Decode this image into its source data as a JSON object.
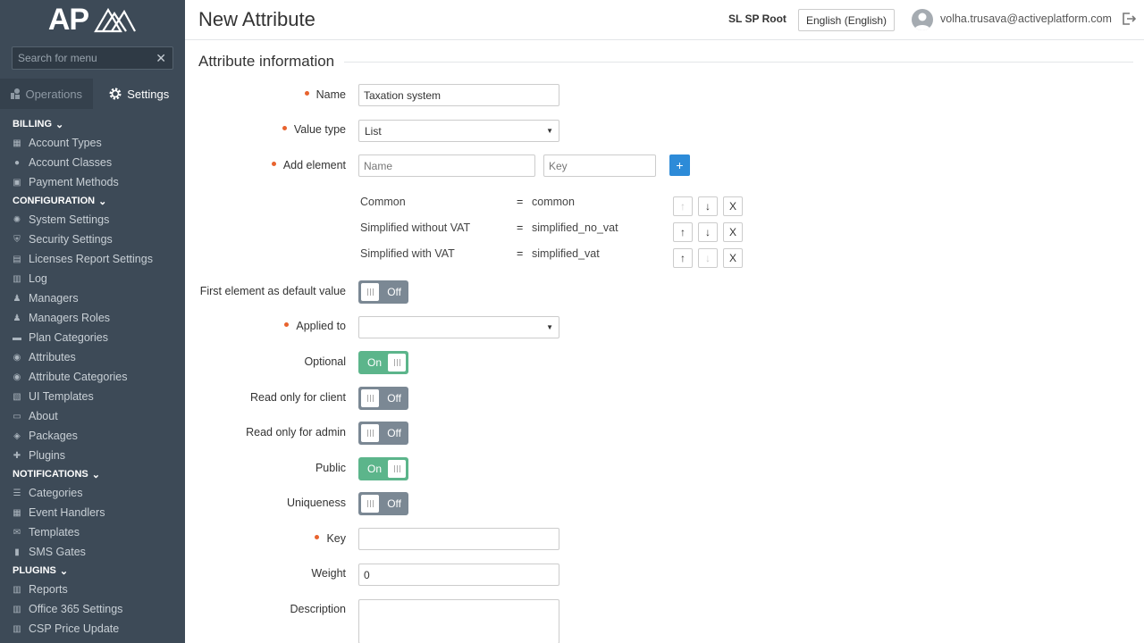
{
  "colors": {
    "sidebar_bg": "#3d4a57",
    "accent_blue": "#2d8bd8",
    "toggle_on": "#5cb58b",
    "toggle_off": "#7b8894",
    "required_dot": "#e8632e"
  },
  "sidebar": {
    "logo_text": "AP",
    "search_placeholder": "Search for menu",
    "tabs": [
      {
        "label": "Operations",
        "icon": "operations-icon"
      },
      {
        "label": "Settings",
        "icon": "gear-icon"
      }
    ],
    "sections": [
      {
        "title": "BILLING",
        "items": [
          {
            "label": "Account Types",
            "icon": "grid-icon"
          },
          {
            "label": "Account Classes",
            "icon": "user-icon"
          },
          {
            "label": "Payment Methods",
            "icon": "payment-icon"
          }
        ]
      },
      {
        "title": "CONFIGURATION",
        "items": [
          {
            "label": "System Settings",
            "icon": "gear-icon"
          },
          {
            "label": "Security Settings",
            "icon": "shield-icon"
          },
          {
            "label": "Licenses Report Settings",
            "icon": "document-icon"
          },
          {
            "label": "Log",
            "icon": "log-icon"
          },
          {
            "label": "Managers",
            "icon": "users-icon"
          },
          {
            "label": "Managers Roles",
            "icon": "users-icon"
          },
          {
            "label": "Plan Categories",
            "icon": "folder-icon"
          },
          {
            "label": "Attributes",
            "icon": "circle-icon"
          },
          {
            "label": "Attribute Categories",
            "icon": "circle-icon"
          },
          {
            "label": "UI Templates",
            "icon": "template-icon"
          },
          {
            "label": "About",
            "icon": "monitor-icon"
          },
          {
            "label": "Packages",
            "icon": "package-icon"
          },
          {
            "label": "Plugins",
            "icon": "plugin-icon"
          }
        ]
      },
      {
        "title": "NOTIFICATIONS",
        "items": [
          {
            "label": "Categories",
            "icon": "list-icon"
          },
          {
            "label": "Event Handlers",
            "icon": "calendar-icon"
          },
          {
            "label": "Templates",
            "icon": "mail-icon"
          },
          {
            "label": "SMS Gates",
            "icon": "sms-icon"
          }
        ]
      },
      {
        "title": "PLUGINS",
        "items": [
          {
            "label": "Reports",
            "icon": "reports-icon"
          },
          {
            "label": "Office 365 Settings",
            "icon": "reports-icon"
          },
          {
            "label": "CSP Price Update",
            "icon": "reports-icon"
          }
        ]
      }
    ]
  },
  "topbar": {
    "title": "New Attribute",
    "account": "SL SP Root",
    "language": "English (English)",
    "email": "volha.trusava@activeplatform.com"
  },
  "form": {
    "section_title": "Attribute information",
    "name_label": "Name",
    "name_value": "Taxation system",
    "value_type_label": "Value type",
    "value_type_value": "List",
    "add_element_label": "Add element",
    "add_name_placeholder": "Name",
    "add_key_placeholder": "Key",
    "add_button": "+",
    "elements": [
      {
        "name": "Common",
        "eq": "=",
        "key": "common"
      },
      {
        "name": "Simplified without VAT",
        "eq": "=",
        "key": "simplified_no_vat"
      },
      {
        "name": "Simplified with VAT",
        "eq": "=",
        "key": "simplified_vat"
      }
    ],
    "move_up": "↑",
    "move_down": "↓",
    "remove": "X",
    "first_default_label": "First element as default value",
    "applied_to_label": "Applied to",
    "applied_to_value": "",
    "optional_label": "Optional",
    "read_only_client_label": "Read only for client",
    "read_only_admin_label": "Read only for admin",
    "public_label": "Public",
    "uniqueness_label": "Uniqueness",
    "key_label": "Key",
    "key_value": "",
    "weight_label": "Weight",
    "weight_value": "0",
    "description_label": "Description",
    "description_value": "",
    "toggles": {
      "first_default": {
        "state": "Off"
      },
      "optional": {
        "state": "On"
      },
      "read_only_client": {
        "state": "Off"
      },
      "read_only_admin": {
        "state": "Off"
      },
      "public": {
        "state": "On"
      },
      "uniqueness": {
        "state": "Off"
      }
    }
  }
}
